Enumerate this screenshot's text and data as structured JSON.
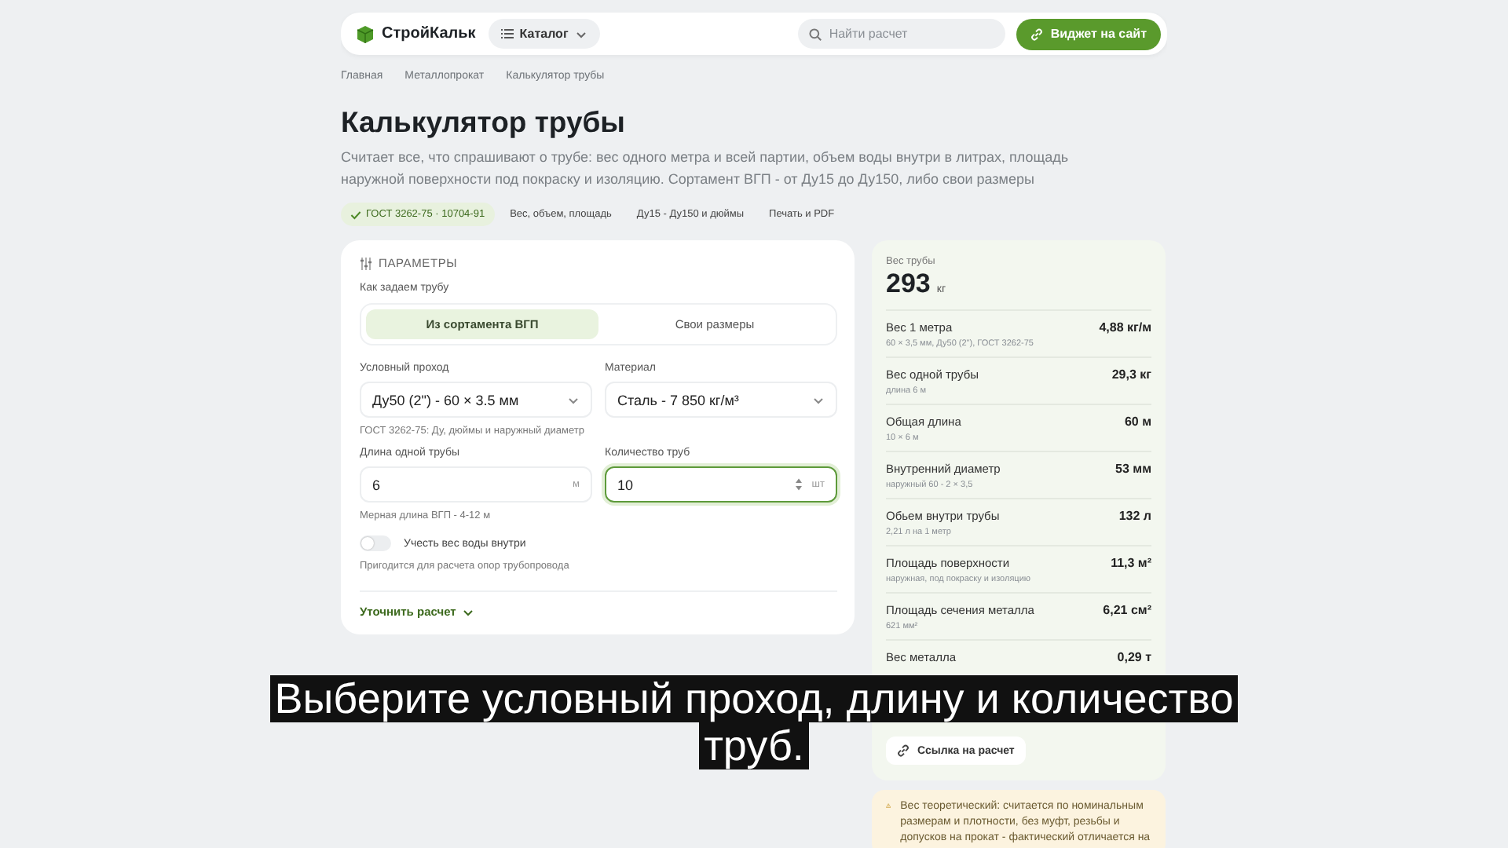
{
  "header": {
    "logo": "СтройКальк",
    "catalog_button": "Каталог",
    "search": {
      "placeholder": "Найти расчет"
    },
    "widget_button": "Виджет на сайт"
  },
  "breadcrumbs": [
    "Главная",
    "Металлопрокат",
    "Калькулятор трубы"
  ],
  "title": "Калькулятор трубы",
  "description": "Считает все, что спрашивают о трубе: вес одного метра и всей партии, объем воды внутри в литрах, площадь наружной поверхности под покраску и изоляцию. Сортамент ВГП - от Ду15 до Ду150, либо свои размеры",
  "chips": [
    {
      "label": "ГОСТ 3262-75 · 10704-91",
      "kind": "check"
    },
    {
      "label": "Вес, объем, площадь",
      "kind": "plain"
    },
    {
      "label": "Ду15 - Ду150 и дюймы",
      "kind": "plain"
    },
    {
      "label": "Печать и PDF",
      "kind": "plain"
    }
  ],
  "parameters": {
    "heading": "ПАРАМЕТРЫ",
    "mode_label": "Как задаем трубу",
    "mode_tabs": [
      {
        "label": "Из сортамента ВГП",
        "selected": true
      },
      {
        "label": "Свои размеры",
        "selected": false
      }
    ],
    "fields": [
      {
        "label": "Условный проход",
        "kind": "select",
        "value": "Ду50 (2\") - 60 × 3.5 мм",
        "hint": "ГОСТ 3262-75: Ду, дюймы и наружный диаметр",
        "focused": false
      },
      {
        "label": "Материал",
        "kind": "select",
        "value": "Сталь - 7 850 кг/м³",
        "focused": false
      },
      {
        "label": "Длина одной трубы",
        "kind": "number",
        "value": "6",
        "unit": "м",
        "hint": "Мерная длина ВГП - 4-12 м",
        "focused": false
      },
      {
        "label": "Количество труб",
        "kind": "stepper",
        "value": "10",
        "unit": "шт",
        "focused": true
      }
    ],
    "water_toggle": {
      "label": "Учесть вес воды внутри",
      "on": false,
      "hint": "Пригодится для расчета опор трубопровода"
    },
    "refine_link": "Уточнить расчет"
  },
  "results": {
    "total_label": "Вес трубы",
    "total_value": "293",
    "total_unit": "кг",
    "rows": [
      {
        "label": "Вес 1 метра",
        "note": "60 × 3,5 мм, Ду50 (2\"), ГОСТ 3262-75",
        "value": "4,88 кг/м"
      },
      {
        "label": "Вес одной трубы",
        "note": "длина 6 м",
        "value": "29,3 кг"
      },
      {
        "label": "Общая длина",
        "note": "10 × 6 м",
        "value": "60 м"
      },
      {
        "label": "Внутренний диаметр",
        "note": "наружный 60 - 2 × 3,5",
        "value": "53 мм"
      },
      {
        "label": "Обьем внутри трубы",
        "note": "2,21 л на 1 метр",
        "value": "132 л"
      },
      {
        "label": "Площадь поверхности",
        "note": "наружная, под покраску и изоляцию",
        "value": "11,3 м²"
      },
      {
        "label": "Площадь сечения металла",
        "note": "621 мм²",
        "value": "6,21 см²"
      },
      {
        "label": "Вес металла",
        "value": "0,29 т"
      }
    ],
    "share_button": "Ссылка на расчет"
  },
  "warning": "Вес теоретический: считается по номинальным размерам и плотности, без муфт, резьбы и допусков на прокат - фактический отличается на",
  "caption_lines": [
    "Выберите условный проход, длину и количество",
    "труб."
  ]
}
